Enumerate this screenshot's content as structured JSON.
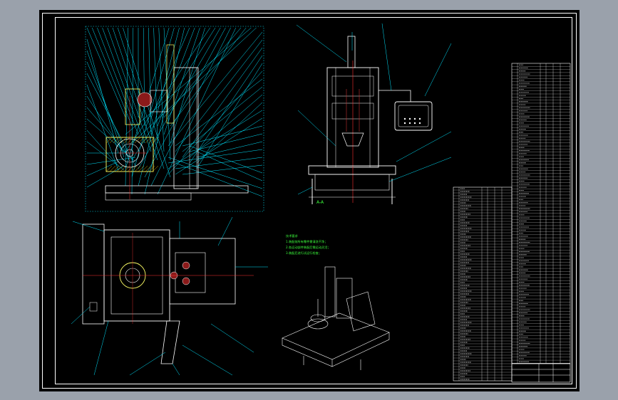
{
  "drawing": {
    "background": "#000000",
    "outer_gray": "#9aa1ab",
    "line_colors": {
      "geometry": "#ffffff",
      "leader": "#00e5ff",
      "centerline": "#ff3030",
      "hatch": "#ffd200",
      "text": "#3cff3c",
      "detail": "#ffff66"
    }
  },
  "views": {
    "section_label": "A-A",
    "notes_lines": [
      "技术要求",
      "1.装配前所有零件需清洗干净；",
      "2.各运动部件装配后需运动灵活；",
      "3.装配后进行试运行检查；"
    ]
  },
  "icons": [
    "leader-callout",
    "centerline",
    "title-block",
    "parts-list"
  ]
}
